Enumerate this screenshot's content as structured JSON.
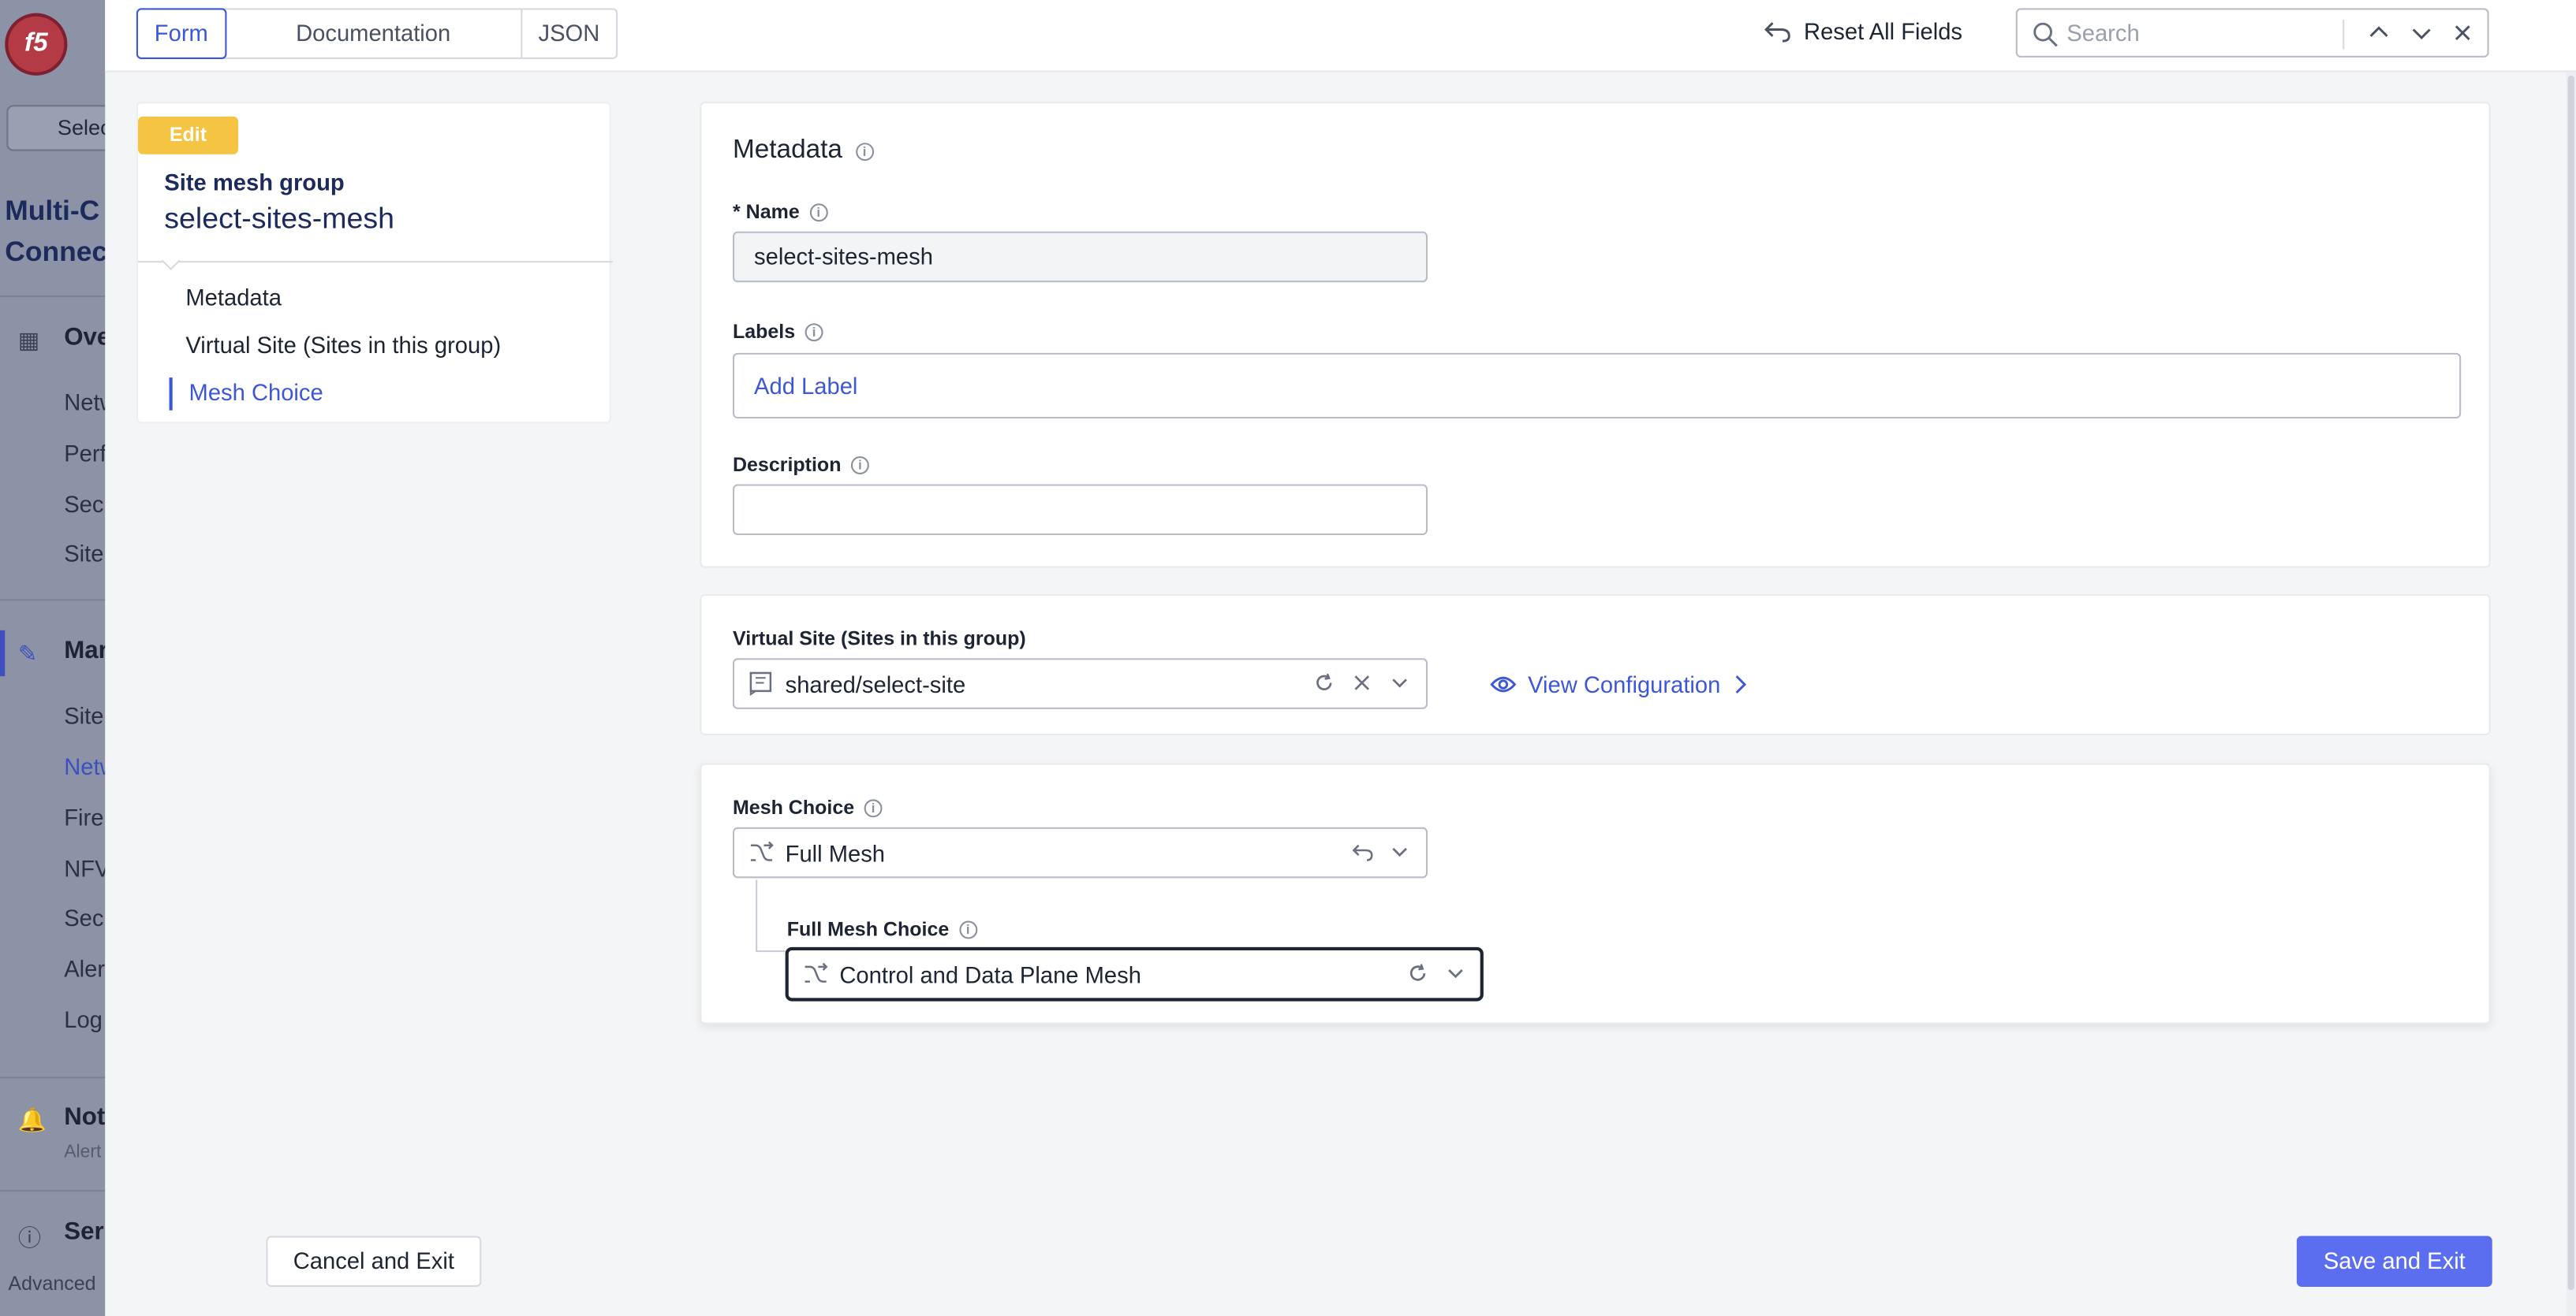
{
  "background_app": {
    "selector_label": "Selec",
    "title": "Multi-C Connec",
    "title_line1": "Multi-C",
    "title_line2": "Connec",
    "sections": [
      {
        "label": "Ove",
        "items": [
          "Netw",
          "Perf",
          "Sec",
          "Site"
        ]
      },
      {
        "label": "Mar",
        "items": [
          "Site",
          "Netw",
          "Fire",
          "NFV",
          "Sec",
          "Aler",
          "Log"
        ]
      },
      {
        "label": "Not",
        "sub": "Alert"
      },
      {
        "label": "Ser"
      }
    ],
    "active_item": "Netw",
    "footer": "Advanced"
  },
  "topbar": {
    "tabs": [
      {
        "label": "Form",
        "active": true
      },
      {
        "label": "Documentation",
        "active": false
      },
      {
        "label": "JSON",
        "active": false
      }
    ],
    "reset_label": "Reset All Fields",
    "search_placeholder": "Search"
  },
  "nav": {
    "badge": "Edit",
    "object_kind": "Site mesh group",
    "object_name": "select-sites-mesh",
    "links": [
      {
        "label": "Metadata",
        "active": false
      },
      {
        "label": "Virtual Site (Sites in this group)",
        "active": false
      },
      {
        "label": "Mesh Choice",
        "active": true
      }
    ]
  },
  "metadata": {
    "title": "Metadata",
    "name_label": "* Name",
    "name_value": "select-sites-mesh",
    "labels_label": "Labels",
    "labels_placeholder": "Add Label",
    "description_label": "Description",
    "description_value": ""
  },
  "virtual_site": {
    "label": "Virtual Site (Sites in this group)",
    "value": "shared/select-site",
    "view_config": "View Configuration"
  },
  "mesh": {
    "label": "Mesh Choice",
    "value": "Full Mesh",
    "sub_label": "Full Mesh Choice",
    "sub_value": "Control and Data Plane Mesh"
  },
  "footer": {
    "cancel": "Cancel and Exit",
    "save": "Save and Exit"
  },
  "colors": {
    "accent": "#3d57d8",
    "primary_button": "#5b6ef0",
    "edit_badge": "#f6c443",
    "overlay": "#8d93a6"
  }
}
